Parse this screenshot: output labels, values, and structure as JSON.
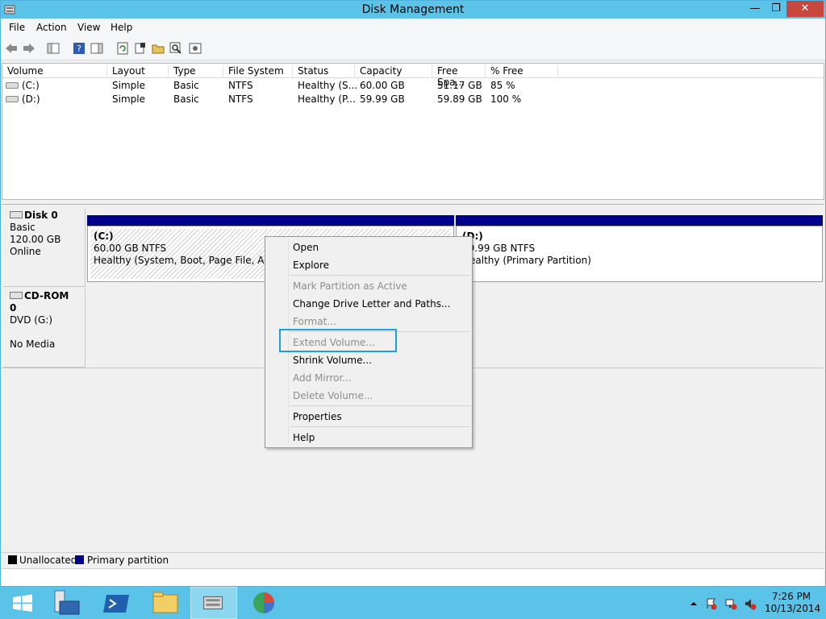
{
  "window": {
    "title": "Disk Management"
  },
  "window_controls": {
    "minimize": "—",
    "maximize": "❐",
    "close": "✕"
  },
  "menu": [
    "File",
    "Action",
    "View",
    "Help"
  ],
  "volume_list": {
    "columns": [
      "Volume",
      "Layout",
      "Type",
      "File System",
      "Status",
      "Capacity",
      "Free Spa...",
      "% Free"
    ],
    "rows": [
      {
        "volume": "(C:)",
        "layout": "Simple",
        "type": "Basic",
        "fs": "NTFS",
        "status": "Healthy (S...",
        "capacity": "60.00 GB",
        "free": "51.17 GB",
        "pct": "85 %"
      },
      {
        "volume": "(D:)",
        "layout": "Simple",
        "type": "Basic",
        "fs": "NTFS",
        "status": "Healthy (P...",
        "capacity": "59.99 GB",
        "free": "59.89 GB",
        "pct": "100 %"
      }
    ]
  },
  "disks": {
    "disk0": {
      "name": "Disk 0",
      "type": "Basic",
      "size": "120.00 GB",
      "state": "Online"
    },
    "cdrom0": {
      "name": "CD-ROM 0",
      "type": "DVD (G:)",
      "state": "No Media"
    }
  },
  "partitions": {
    "c": {
      "label": "(C:)",
      "size": "60.00 GB NTFS",
      "status": "Healthy (System, Boot, Page File, Active,"
    },
    "d": {
      "label": "(D:)",
      "size": "59.99 GB NTFS",
      "status": "Healthy (Primary Partition)"
    }
  },
  "context_menu": {
    "open": "Open",
    "explore": "Explore",
    "mark_active": "Mark Partition as Active",
    "change_letter": "Change Drive Letter and Paths...",
    "format": "Format...",
    "extend": "Extend Volume...",
    "shrink": "Shrink Volume...",
    "add_mirror": "Add Mirror...",
    "delete": "Delete Volume...",
    "properties": "Properties",
    "help": "Help"
  },
  "legend": {
    "unallocated": "Unallocated",
    "primary": "Primary partition"
  },
  "colors": {
    "titlebar": "#5cc3e8",
    "primary_partition": "#00008b",
    "unallocated": "#000000",
    "highlight": "#1e9fd9"
  },
  "taskbar": {
    "icons": [
      "windows-start-icon",
      "server-manager-icon",
      "powershell-icon",
      "file-explorer-icon",
      "disk-management-icon",
      "partition-tool-icon"
    ],
    "time": "7:26 PM",
    "date": "10/13/2014"
  }
}
